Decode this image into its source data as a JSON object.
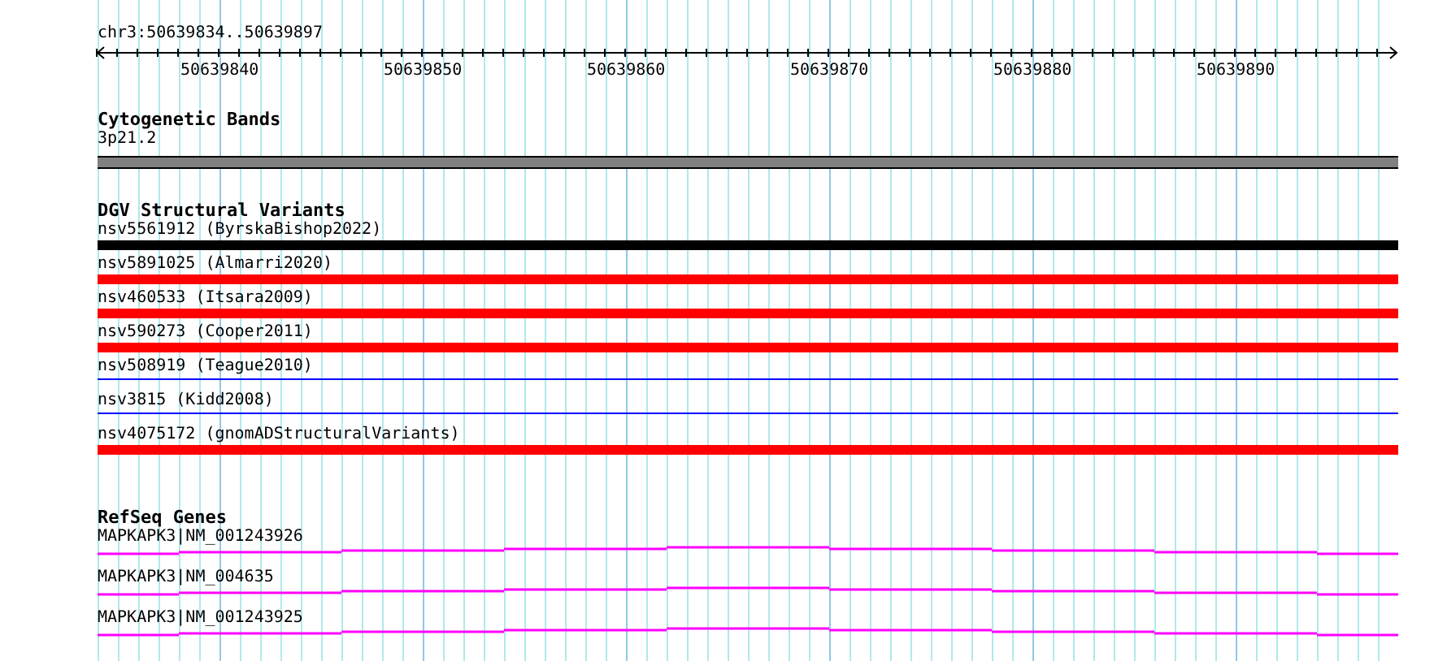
{
  "ruler": {
    "location": "chr3:50639834..50639897",
    "ticks": [
      "50639840",
      "50639850",
      "50639860",
      "50639870",
      "50639880",
      "50639890"
    ]
  },
  "cytogenetic_bands": {
    "title": "Cytogenetic Bands",
    "band": "3p21.2"
  },
  "dgv_structural_variants": {
    "title": "DGV Structural Variants",
    "items": [
      {
        "label": "nsv5561912 (ByrskaBishop2022)",
        "kind": "bar",
        "color": "#000000"
      },
      {
        "label": "nsv5891025 (Almarri2020)",
        "kind": "bar",
        "color": "#ff0000"
      },
      {
        "label": "nsv460533 (Itsara2009)",
        "kind": "bar",
        "color": "#ff0000"
      },
      {
        "label": "nsv590273 (Cooper2011)",
        "kind": "bar",
        "color": "#ff0000"
      },
      {
        "label": "nsv508919 (Teague2010)",
        "kind": "line",
        "color": "#0000ff"
      },
      {
        "label": "nsv3815 (Kidd2008)",
        "kind": "line",
        "color": "#0000ff"
      },
      {
        "label": "nsv4075172 (gnomADStructuralVariants)",
        "kind": "bar",
        "color": "#ff0000"
      }
    ]
  },
  "refseq_genes": {
    "title": "RefSeq Genes",
    "items": [
      {
        "label": "MAPKAPK3|NM_001243926"
      },
      {
        "label": "MAPKAPK3|NM_004635"
      },
      {
        "label": "MAPKAPK3|NM_001243925"
      }
    ]
  }
}
